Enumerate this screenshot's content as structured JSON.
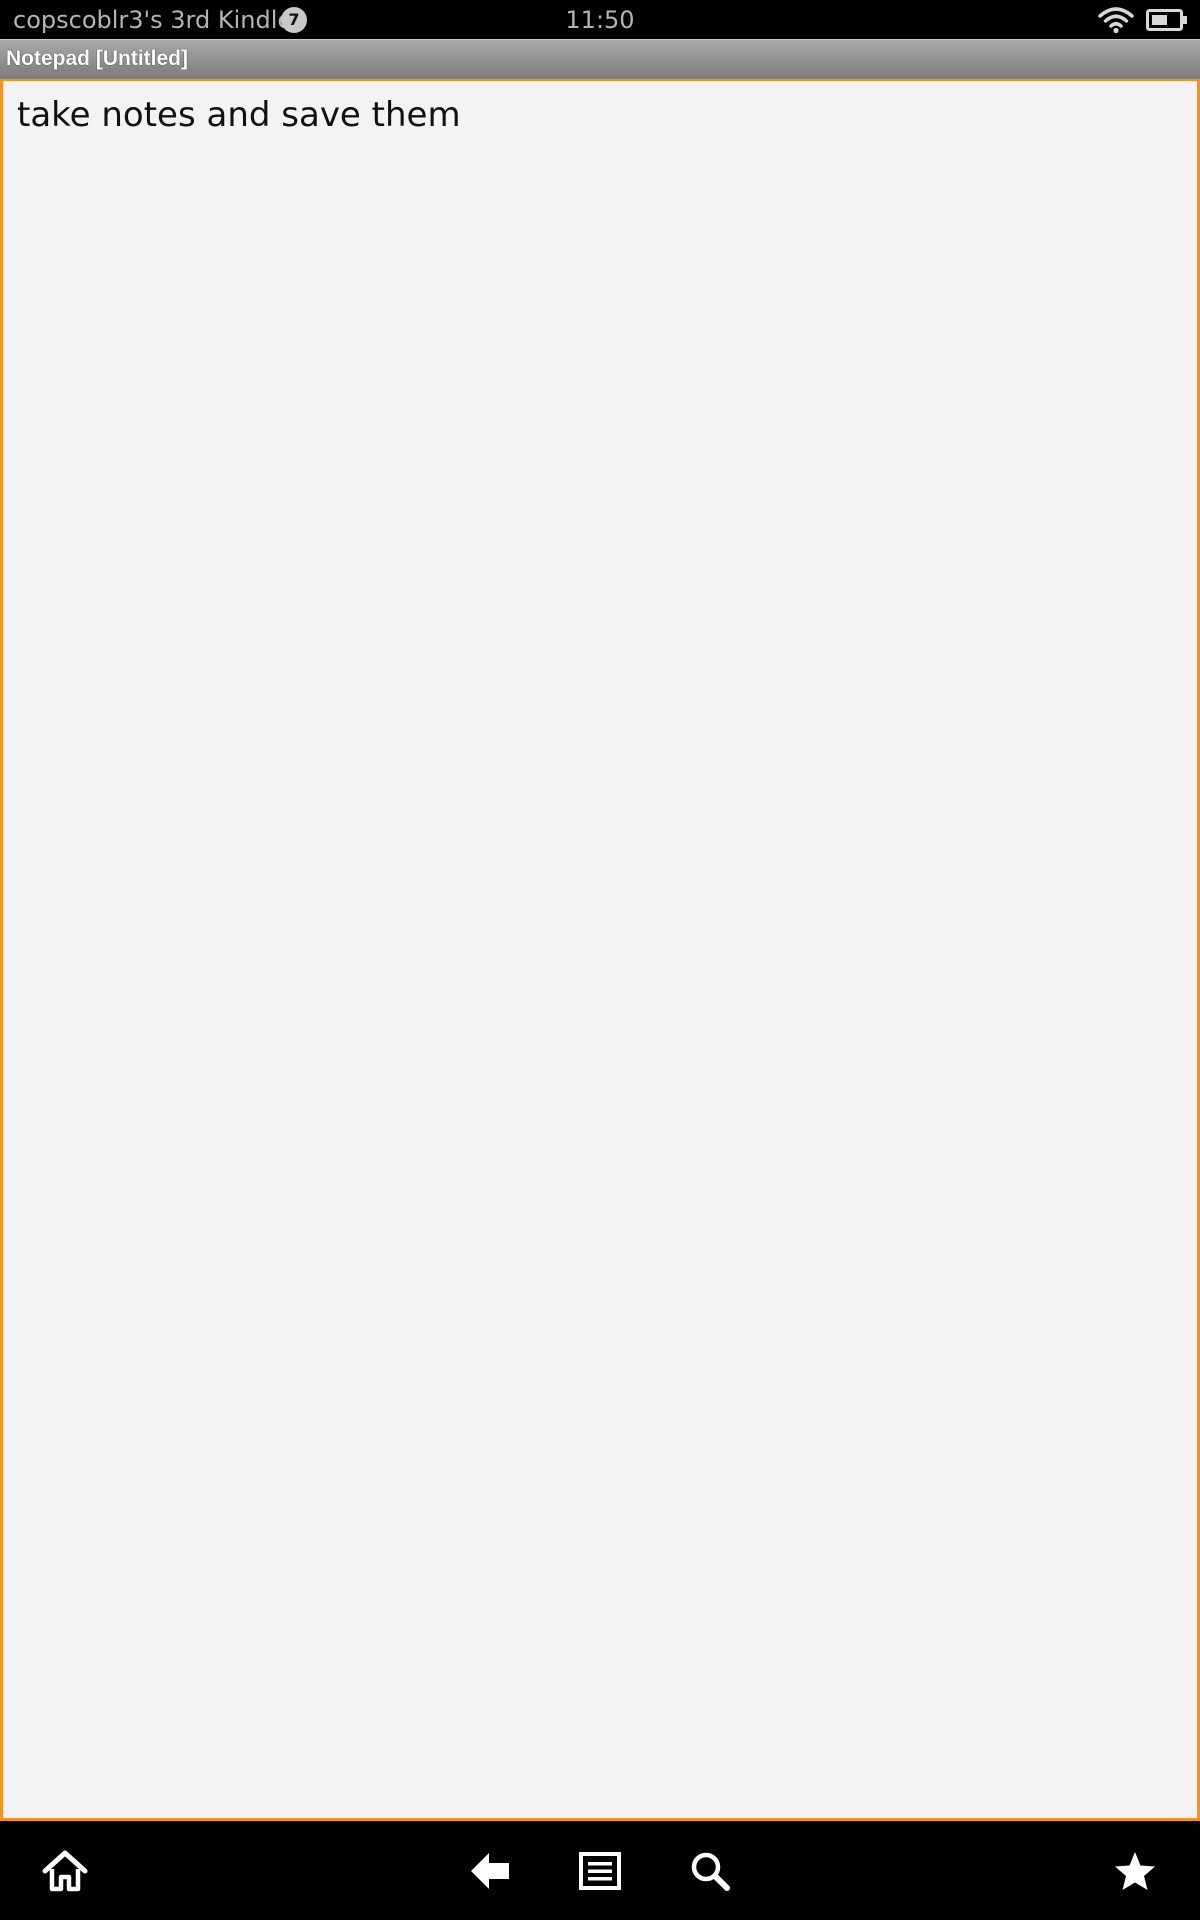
{
  "status_bar": {
    "device_name": "copscoblr3's 3rd Kindle",
    "notification_count": "7",
    "time": "11:50",
    "wifi_icon": "wifi-icon",
    "battery_icon": "battery-icon"
  },
  "app": {
    "title": "Notepad [Untitled]"
  },
  "editor": {
    "text": "take notes and save them",
    "border_color": "#f4931f",
    "background": "#f3f3f3"
  },
  "nav": {
    "icons": [
      "home-icon",
      "back-arrow-icon",
      "menu-icon",
      "search-icon",
      "star-icon"
    ]
  }
}
